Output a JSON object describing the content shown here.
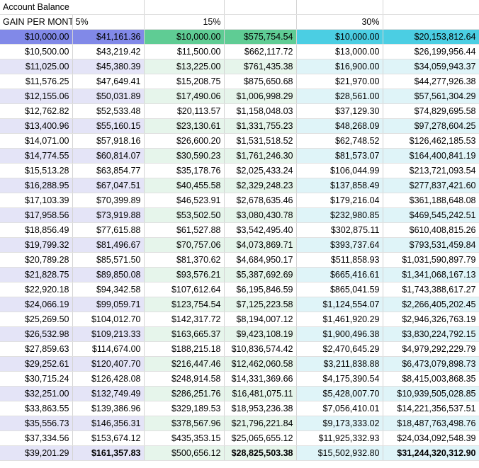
{
  "title": "Account Balance",
  "gain_label": "GAIN PER MONTH:",
  "groups": [
    {
      "rate": "5%",
      "accent": "#8189E8",
      "band": "#E4E4F7"
    },
    {
      "rate": "15%",
      "accent": "#5FCC94",
      "band": "#E6F5EB"
    },
    {
      "rate": "30%",
      "accent": "#4BCEE3",
      "band": "#DFF4F8"
    }
  ],
  "rows": [
    {
      "c1": "$10,000.00",
      "c2": "$41,161.36",
      "c3": "$10,000.00",
      "c4": "$575,754.54",
      "c5": "$10,000.00",
      "c6": "$20,153,812.64"
    },
    {
      "c1": "$10,500.00",
      "c2": "$43,219.42",
      "c3": "$11,500.00",
      "c4": "$662,117.72",
      "c5": "$13,000.00",
      "c6": "$26,199,956.44"
    },
    {
      "c1": "$11,025.00",
      "c2": "$45,380.39",
      "c3": "$13,225.00",
      "c4": "$761,435.38",
      "c5": "$16,900.00",
      "c6": "$34,059,943.37"
    },
    {
      "c1": "$11,576.25",
      "c2": "$47,649.41",
      "c3": "$15,208.75",
      "c4": "$875,650.68",
      "c5": "$21,970.00",
      "c6": "$44,277,926.38"
    },
    {
      "c1": "$12,155.06",
      "c2": "$50,031.89",
      "c3": "$17,490.06",
      "c4": "$1,006,998.29",
      "c5": "$28,561.00",
      "c6": "$57,561,304.29"
    },
    {
      "c1": "$12,762.82",
      "c2": "$52,533.48",
      "c3": "$20,113.57",
      "c4": "$1,158,048.03",
      "c5": "$37,129.30",
      "c6": "$74,829,695.58"
    },
    {
      "c1": "$13,400.96",
      "c2": "$55,160.15",
      "c3": "$23,130.61",
      "c4": "$1,331,755.23",
      "c5": "$48,268.09",
      "c6": "$97,278,604.25"
    },
    {
      "c1": "$14,071.00",
      "c2": "$57,918.16",
      "c3": "$26,600.20",
      "c4": "$1,531,518.52",
      "c5": "$62,748.52",
      "c6": "$126,462,185.53"
    },
    {
      "c1": "$14,774.55",
      "c2": "$60,814.07",
      "c3": "$30,590.23",
      "c4": "$1,761,246.30",
      "c5": "$81,573.07",
      "c6": "$164,400,841.19"
    },
    {
      "c1": "$15,513.28",
      "c2": "$63,854.77",
      "c3": "$35,178.76",
      "c4": "$2,025,433.24",
      "c5": "$106,044.99",
      "c6": "$213,721,093.54"
    },
    {
      "c1": "$16,288.95",
      "c2": "$67,047.51",
      "c3": "$40,455.58",
      "c4": "$2,329,248.23",
      "c5": "$137,858.49",
      "c6": "$277,837,421.60"
    },
    {
      "c1": "$17,103.39",
      "c2": "$70,399.89",
      "c3": "$46,523.91",
      "c4": "$2,678,635.46",
      "c5": "$179,216.04",
      "c6": "$361,188,648.08"
    },
    {
      "c1": "$17,958.56",
      "c2": "$73,919.88",
      "c3": "$53,502.50",
      "c4": "$3,080,430.78",
      "c5": "$232,980.85",
      "c6": "$469,545,242.51"
    },
    {
      "c1": "$18,856.49",
      "c2": "$77,615.88",
      "c3": "$61,527.88",
      "c4": "$3,542,495.40",
      "c5": "$302,875.11",
      "c6": "$610,408,815.26"
    },
    {
      "c1": "$19,799.32",
      "c2": "$81,496.67",
      "c3": "$70,757.06",
      "c4": "$4,073,869.71",
      "c5": "$393,737.64",
      "c6": "$793,531,459.84"
    },
    {
      "c1": "$20,789.28",
      "c2": "$85,571.50",
      "c3": "$81,370.62",
      "c4": "$4,684,950.17",
      "c5": "$511,858.93",
      "c6": "$1,031,590,897.79"
    },
    {
      "c1": "$21,828.75",
      "c2": "$89,850.08",
      "c3": "$93,576.21",
      "c4": "$5,387,692.69",
      "c5": "$665,416.61",
      "c6": "$1,341,068,167.13"
    },
    {
      "c1": "$22,920.18",
      "c2": "$94,342.58",
      "c3": "$107,612.64",
      "c4": "$6,195,846.59",
      "c5": "$865,041.59",
      "c6": "$1,743,388,617.27"
    },
    {
      "c1": "$24,066.19",
      "c2": "$99,059.71",
      "c3": "$123,754.54",
      "c4": "$7,125,223.58",
      "c5": "$1,124,554.07",
      "c6": "$2,266,405,202.45"
    },
    {
      "c1": "$25,269.50",
      "c2": "$104,012.70",
      "c3": "$142,317.72",
      "c4": "$8,194,007.12",
      "c5": "$1,461,920.29",
      "c6": "$2,946,326,763.19"
    },
    {
      "c1": "$26,532.98",
      "c2": "$109,213.33",
      "c3": "$163,665.37",
      "c4": "$9,423,108.19",
      "c5": "$1,900,496.38",
      "c6": "$3,830,224,792.15"
    },
    {
      "c1": "$27,859.63",
      "c2": "$114,674.00",
      "c3": "$188,215.18",
      "c4": "$10,836,574.42",
      "c5": "$2,470,645.29",
      "c6": "$4,979,292,229.79"
    },
    {
      "c1": "$29,252.61",
      "c2": "$120,407.70",
      "c3": "$216,447.46",
      "c4": "$12,462,060.58",
      "c5": "$3,211,838.88",
      "c6": "$6,473,079,898.73"
    },
    {
      "c1": "$30,715.24",
      "c2": "$126,428.08",
      "c3": "$248,914.58",
      "c4": "$14,331,369.66",
      "c5": "$4,175,390.54",
      "c6": "$8,415,003,868.35"
    },
    {
      "c1": "$32,251.00",
      "c2": "$132,749.49",
      "c3": "$286,251.76",
      "c4": "$16,481,075.11",
      "c5": "$5,428,007.70",
      "c6": "$10,939,505,028.85"
    },
    {
      "c1": "$33,863.55",
      "c2": "$139,386.96",
      "c3": "$329,189.53",
      "c4": "$18,953,236.38",
      "c5": "$7,056,410.01",
      "c6": "$14,221,356,537.51"
    },
    {
      "c1": "$35,556.73",
      "c2": "$146,356.31",
      "c3": "$378,567.96",
      "c4": "$21,796,221.84",
      "c5": "$9,173,333.02",
      "c6": "$18,487,763,498.76"
    },
    {
      "c1": "$37,334.56",
      "c2": "$153,674.12",
      "c3": "$435,353.15",
      "c4": "$25,065,655.12",
      "c5": "$11,925,332.93",
      "c6": "$24,034,092,548.39"
    },
    {
      "c1": "$39,201.29",
      "c2": "$161,357.83",
      "c3": "$500,656.12",
      "c4": "$28,825,503.38",
      "c5": "$15,502,932.80",
      "c6": "$31,244,320,312.90"
    }
  ],
  "bold_final": {
    "c2": true,
    "c4": true,
    "c6": true
  }
}
